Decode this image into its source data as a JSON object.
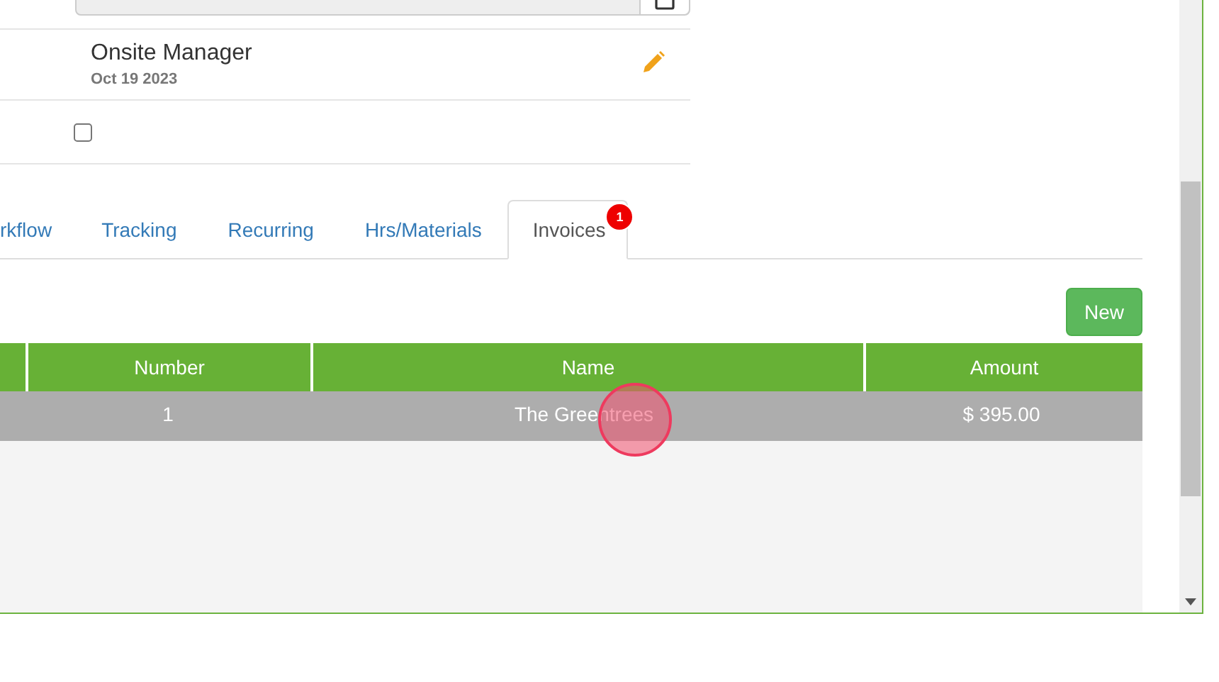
{
  "assignment": {
    "role": "Onsite Manager",
    "date": "Oct 19 2023",
    "checked": false
  },
  "tabs": [
    {
      "label": "rkflow",
      "selected": false
    },
    {
      "label": "Tracking",
      "selected": false
    },
    {
      "label": "Recurring",
      "selected": false
    },
    {
      "label": "Hrs/Materials",
      "selected": false
    },
    {
      "label": "Invoices",
      "selected": true,
      "badge": "1"
    }
  ],
  "new_button": "New",
  "table": {
    "columns": [
      null,
      "Number",
      "Name",
      "Amount"
    ],
    "rows": [
      {
        "selected": true,
        "cells": [
          null,
          "1",
          "The Greentrees",
          "$ 395.00"
        ]
      }
    ]
  }
}
